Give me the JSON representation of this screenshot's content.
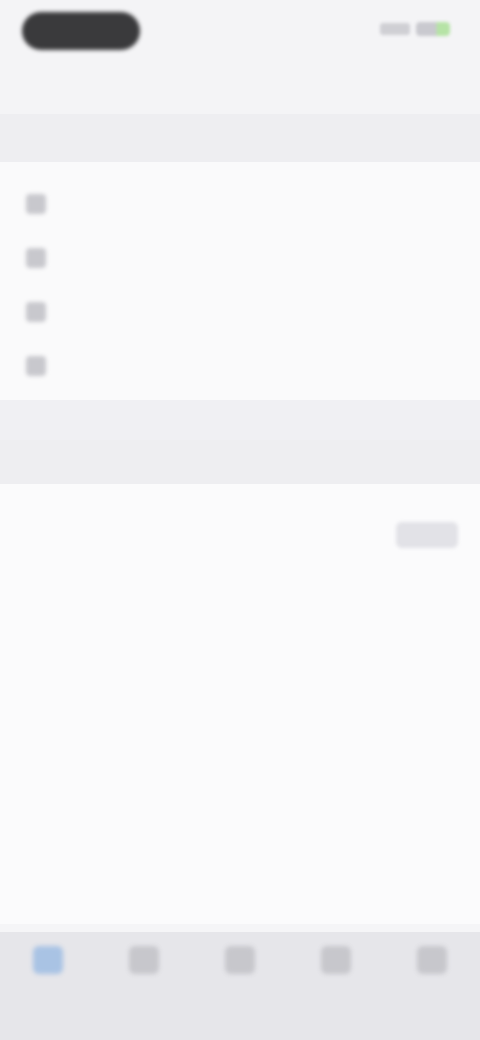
{
  "status_bar": {
    "time": "",
    "battery_color": "#b6e3a6"
  },
  "header": {
    "title": ""
  },
  "section": {
    "label": ""
  },
  "menu": {
    "items": [
      {
        "label": "",
        "icon": "list-icon"
      },
      {
        "label": "",
        "icon": "grid-icon"
      },
      {
        "label": "",
        "icon": "box-icon"
      },
      {
        "label": "",
        "icon": "settings-icon"
      }
    ]
  },
  "section2": {
    "label": ""
  },
  "content": {
    "info_text": "",
    "info_sub": "",
    "action_label": ""
  },
  "tab_bar": {
    "tabs": [
      {
        "label": "",
        "icon": "home-icon",
        "active": true
      },
      {
        "label": "",
        "icon": "tab2-icon",
        "active": false
      },
      {
        "label": "",
        "icon": "tab3-icon",
        "active": false
      },
      {
        "label": "",
        "icon": "tab4-icon",
        "active": false
      },
      {
        "label": "",
        "icon": "profile-icon",
        "active": false
      }
    ]
  }
}
